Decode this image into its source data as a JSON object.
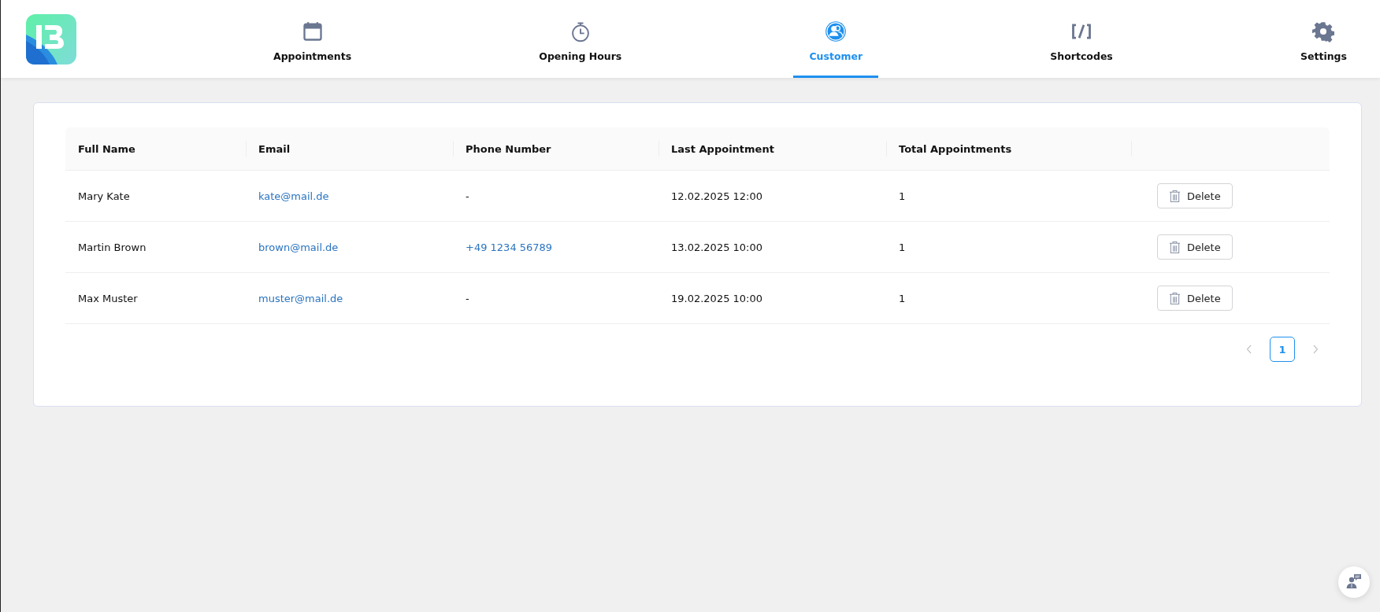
{
  "nav": [
    {
      "label": "Appointments",
      "kind": "calendar",
      "selected": false
    },
    {
      "label": "Opening Hours",
      "kind": "stopwatch",
      "selected": false
    },
    {
      "label": "Customer",
      "kind": "users",
      "selected": true
    },
    {
      "label": "Shortcodes",
      "kind": "shortcode",
      "selected": false
    },
    {
      "label": "Settings",
      "kind": "gear",
      "selected": false
    }
  ],
  "table": {
    "columns": [
      "Full Name",
      "Email",
      "Phone Number",
      "Last Appointment",
      "Total Appointments"
    ],
    "rows": [
      {
        "name": "Mary Kate",
        "email": "kate@mail.de",
        "phone": {
          "text": "-",
          "link": false
        },
        "last": "12.02.2025 12:00",
        "total": "1",
        "action": "Delete"
      },
      {
        "name": "Martin Brown",
        "email": "brown@mail.de",
        "phone": {
          "text": "+49 1234 56789",
          "link": true
        },
        "last": "13.02.2025 10:00",
        "total": "1",
        "action": "Delete"
      },
      {
        "name": "Max Muster",
        "email": "muster@mail.de",
        "phone": {
          "text": "-",
          "link": false
        },
        "last": "19.02.2025 10:00",
        "total": "1",
        "action": "Delete"
      }
    ]
  },
  "pagination": {
    "pages": [
      {
        "label": "1",
        "selected": true
      }
    ]
  }
}
